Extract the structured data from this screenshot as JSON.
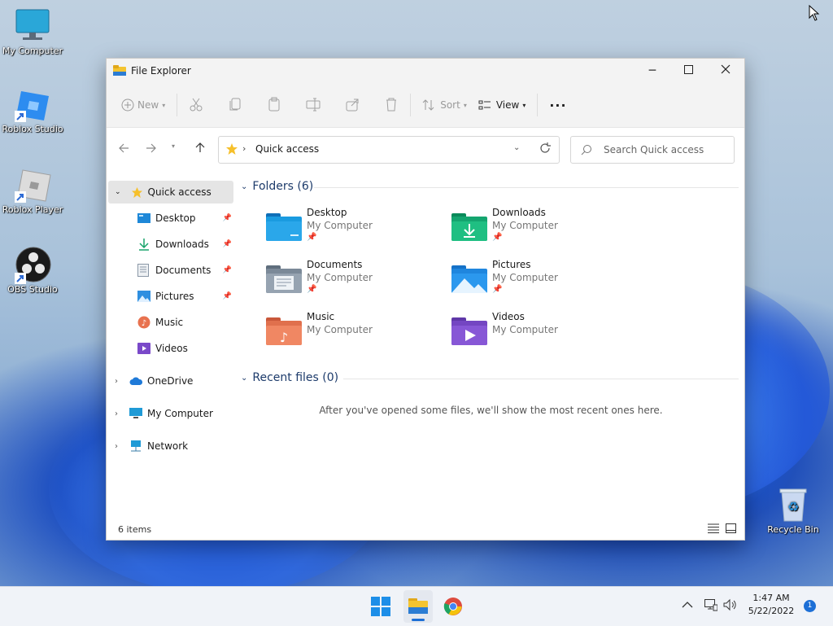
{
  "desktop": {
    "icons": [
      {
        "label": "My Computer",
        "icon": "monitor-icon"
      },
      {
        "label": "Roblox Studio",
        "icon": "roblox-studio-icon"
      },
      {
        "label": "Roblox Player",
        "icon": "roblox-player-icon"
      },
      {
        "label": "OBS Studio",
        "icon": "obs-icon"
      },
      {
        "label": "Recycle Bin",
        "icon": "recycle-bin-icon"
      }
    ]
  },
  "window": {
    "title": "File Explorer",
    "toolbar": {
      "new": "New",
      "sort": "Sort",
      "view": "View",
      "more": "···"
    },
    "address": {
      "location": "Quick access"
    },
    "search": {
      "placeholder": "Search Quick access"
    },
    "sidebar": {
      "quick_access": "Quick access",
      "items": [
        {
          "label": "Desktop",
          "icon": "desktop-icon"
        },
        {
          "label": "Downloads",
          "icon": "downloads-icon"
        },
        {
          "label": "Documents",
          "icon": "documents-icon"
        },
        {
          "label": "Pictures",
          "icon": "pictures-icon"
        },
        {
          "label": "Music",
          "icon": "music-icon"
        },
        {
          "label": "Videos",
          "icon": "videos-icon"
        }
      ],
      "onedrive": "OneDrive",
      "my_computer": "My Computer",
      "network": "Network"
    },
    "main": {
      "folders_header": "Folders (6)",
      "folders": [
        {
          "name": "Desktop",
          "location": "My Computer",
          "pinned": true
        },
        {
          "name": "Downloads",
          "location": "My Computer",
          "pinned": true
        },
        {
          "name": "Documents",
          "location": "My Computer",
          "pinned": true
        },
        {
          "name": "Pictures",
          "location": "My Computer",
          "pinned": true
        },
        {
          "name": "Music",
          "location": "My Computer",
          "pinned": false
        },
        {
          "name": "Videos",
          "location": "My Computer",
          "pinned": false
        }
      ],
      "recent_header": "Recent files (0)",
      "recent_empty": "After you've opened some files, we'll show the most recent ones here."
    },
    "status": {
      "items": "6 items"
    }
  },
  "taskbar": {
    "time": "1:47 AM",
    "date": "5/22/2022",
    "notification_count": "1"
  }
}
